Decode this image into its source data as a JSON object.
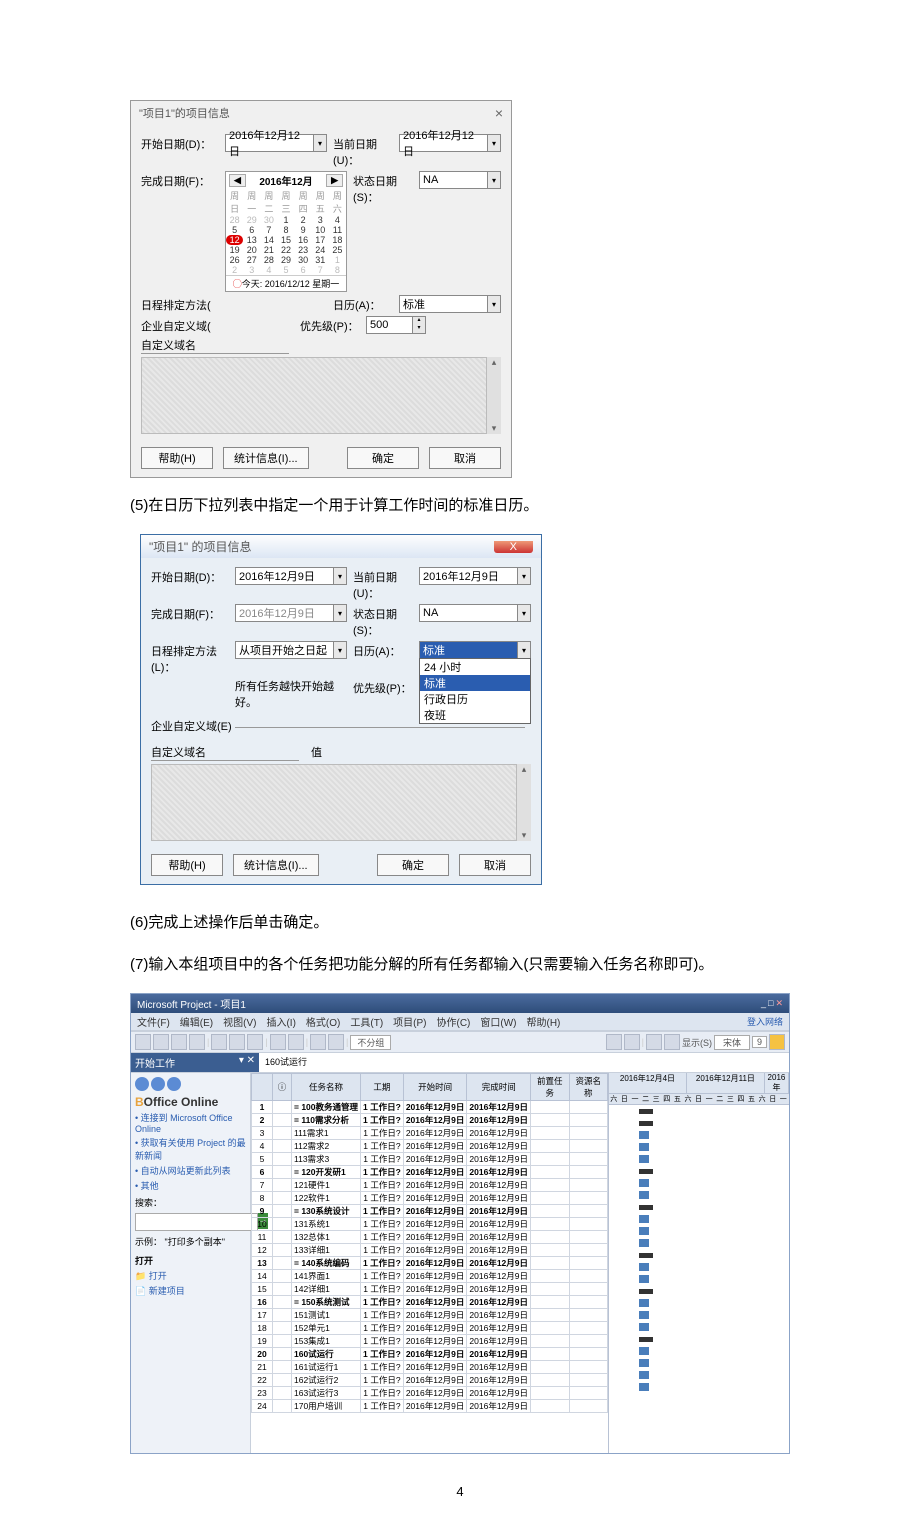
{
  "dlg1": {
    "title": "\"项目1\"的项目信息",
    "start_lbl": "开始日期(D)：",
    "start_val": "2016年12月12日",
    "end_lbl": "完成日期(F)：",
    "cal_month": "2016年12月",
    "cal_dow": [
      "周日",
      "周一",
      "周二",
      "周三",
      "周四",
      "周五",
      "周六"
    ],
    "cal_rows": [
      [
        "28",
        "29",
        "30",
        "1",
        "2",
        "3",
        "4"
      ],
      [
        "5",
        "6",
        "7",
        "8",
        "9",
        "10",
        "11"
      ],
      [
        "12",
        "13",
        "14",
        "15",
        "16",
        "17",
        "18"
      ],
      [
        "19",
        "20",
        "21",
        "22",
        "23",
        "24",
        "25"
      ],
      [
        "26",
        "27",
        "28",
        "29",
        "30",
        "31",
        "1"
      ],
      [
        "2",
        "3",
        "4",
        "5",
        "6",
        "7",
        "8"
      ]
    ],
    "cal_today": "今天: 2016/12/12 星期一",
    "sched_lbl": "日程排定方法(",
    "ent_lbl": "企业自定义域(",
    "fld_lbl": "自定义域名",
    "cur_lbl": "当前日期(U)：",
    "cur_val": "2016年12月12日",
    "stat_lbl": "状态日期(S)：",
    "stat_val": "NA",
    "calsel_lbl": "日历(A)：",
    "calsel_val": "标准",
    "prio_lbl": "优先级(P)：",
    "prio_val": "500",
    "help": "帮助(H)",
    "stats": "统计信息(I)...",
    "ok": "确定",
    "cancel": "取消"
  },
  "p5": "(5)在日历下拉列表中指定一个用于计算工作时间的标准日历。",
  "dlg2": {
    "title": "\"项目1\" 的项目信息",
    "start_lbl": "开始日期(D)：",
    "start_val": "2016年12月9日",
    "end_lbl": "完成日期(F)：",
    "end_val": "2016年12月9日",
    "sched_lbl": "日程排定方法(L)：",
    "sched_val": "从项目开始之日起",
    "note": "所有任务越快开始越好。",
    "ent_lbl": "企业自定义域(E)",
    "fld_lbl": "自定义域名",
    "val_lbl": "值",
    "cur_lbl": "当前日期(U)：",
    "cur_val": "2016年12月9日",
    "stat_lbl": "状态日期(S)：",
    "stat_val": "NA",
    "calsel_lbl": "日历(A)：",
    "prio_lbl": "优先级(P)：",
    "dd": {
      "o1": "24 小时",
      "sel": "标准",
      "o2": "行政日历",
      "o3": "夜班"
    },
    "help": "帮助(H)",
    "stats": "统计信息(I)...",
    "ok": "确定",
    "cancel": "取消"
  },
  "p6": "(6)完成上述操作后单击确定。",
  "p7": "(7)输入本组项目中的各个任务把功能分解的所有任务都输入(只需要输入任务名称即可)。",
  "msp": {
    "title": "Microsoft Project - 项目1",
    "login": "登入网络",
    "menu": [
      "文件(F)",
      "编辑(E)",
      "视图(V)",
      "插入(I)",
      "格式(O)",
      "工具(T)",
      "项目(P)",
      "协作(C)",
      "窗口(W)",
      "帮助(H)"
    ],
    "nogrp": "不分组",
    "show": "显示(S)",
    "font": "宋体",
    "fsize": "9",
    "pane_title": "开始工作",
    "celledit": "160试运行",
    "office": "Office Online",
    "links": [
      "连接到 Microsoft Office Online",
      "获取有关使用 Project 的最新新闻",
      "自动从网站更新此列表",
      "其他"
    ],
    "search_lbl": "搜索：",
    "eg_lbl": "示例：",
    "eg": "\"打印多个副本\"",
    "open": "打开",
    "open2": "打开",
    "new": "新建项目",
    "cols": {
      "id": "",
      "info": "ⓘ",
      "name": "任务名称",
      "dur": "工期",
      "start": "开始时间",
      "finish": "完成时间",
      "pred": "前置任务",
      "res": "资源名称"
    },
    "g1": "2016年12月4日",
    "g2": "2016年12月11日",
    "g3": "2016年",
    "gdays": "六日一二三四五六日一二三四五六日一",
    "rows": [
      {
        "n": 1,
        "b": 1,
        "name": "= 100教务通管理",
        "dur": "1 工作日?",
        "s": "2016年12月9日",
        "f": "2016年12月9日"
      },
      {
        "n": 2,
        "b": 1,
        "name": "= 110需求分析",
        "dur": "1 工作日?",
        "s": "2016年12月9日",
        "f": "2016年12月9日"
      },
      {
        "n": 3,
        "name": "111需求1",
        "dur": "1 工作日?",
        "s": "2016年12月9日",
        "f": "2016年12月9日"
      },
      {
        "n": 4,
        "name": "112需求2",
        "dur": "1 工作日?",
        "s": "2016年12月9日",
        "f": "2016年12月9日"
      },
      {
        "n": 5,
        "name": "113需求3",
        "dur": "1 工作日?",
        "s": "2016年12月9日",
        "f": "2016年12月9日"
      },
      {
        "n": 6,
        "b": 1,
        "name": "= 120开发研1",
        "dur": "1 工作日?",
        "s": "2016年12月9日",
        "f": "2016年12月9日"
      },
      {
        "n": 7,
        "name": "121硬件1",
        "dur": "1 工作日?",
        "s": "2016年12月9日",
        "f": "2016年12月9日"
      },
      {
        "n": 8,
        "name": "122软件1",
        "dur": "1 工作日?",
        "s": "2016年12月9日",
        "f": "2016年12月9日"
      },
      {
        "n": 9,
        "b": 1,
        "name": "= 130系统设计",
        "dur": "1 工作日?",
        "s": "2016年12月9日",
        "f": "2016年12月9日"
      },
      {
        "n": 10,
        "name": "131系统1",
        "dur": "1 工作日?",
        "s": "2016年12月9日",
        "f": "2016年12月9日"
      },
      {
        "n": 11,
        "name": "132总体1",
        "dur": "1 工作日?",
        "s": "2016年12月9日",
        "f": "2016年12月9日"
      },
      {
        "n": 12,
        "name": "133详细1",
        "dur": "1 工作日?",
        "s": "2016年12月9日",
        "f": "2016年12月9日"
      },
      {
        "n": 13,
        "b": 1,
        "name": "= 140系统编码",
        "dur": "1 工作日?",
        "s": "2016年12月9日",
        "f": "2016年12月9日"
      },
      {
        "n": 14,
        "name": "141界面1",
        "dur": "1 工作日?",
        "s": "2016年12月9日",
        "f": "2016年12月9日"
      },
      {
        "n": 15,
        "name": "142详细1",
        "dur": "1 工作日?",
        "s": "2016年12月9日",
        "f": "2016年12月9日"
      },
      {
        "n": 16,
        "b": 1,
        "name": "= 150系统测试",
        "dur": "1 工作日?",
        "s": "2016年12月9日",
        "f": "2016年12月9日"
      },
      {
        "n": 17,
        "name": "151测试1",
        "dur": "1 工作日?",
        "s": "2016年12月9日",
        "f": "2016年12月9日"
      },
      {
        "n": 18,
        "name": "152单元1",
        "dur": "1 工作日?",
        "s": "2016年12月9日",
        "f": "2016年12月9日"
      },
      {
        "n": 19,
        "name": "153集成1",
        "dur": "1 工作日?",
        "s": "2016年12月9日",
        "f": "2016年12月9日"
      },
      {
        "n": 20,
        "b": 1,
        "name": "160试运行",
        "dur": "1 工作日?",
        "s": "2016年12月9日",
        "f": "2016年12月9日"
      },
      {
        "n": 21,
        "name": "161试运行1",
        "dur": "1 工作日?",
        "s": "2016年12月9日",
        "f": "2016年12月9日"
      },
      {
        "n": 22,
        "name": "162试运行2",
        "dur": "1 工作日?",
        "s": "2016年12月9日",
        "f": "2016年12月9日"
      },
      {
        "n": 23,
        "name": "163试运行3",
        "dur": "1 工作日?",
        "s": "2016年12月9日",
        "f": "2016年12月9日"
      },
      {
        "n": 24,
        "name": "170用户培训",
        "dur": "1 工作日?",
        "s": "2016年12月9日",
        "f": "2016年12月9日"
      }
    ]
  },
  "page": "4"
}
